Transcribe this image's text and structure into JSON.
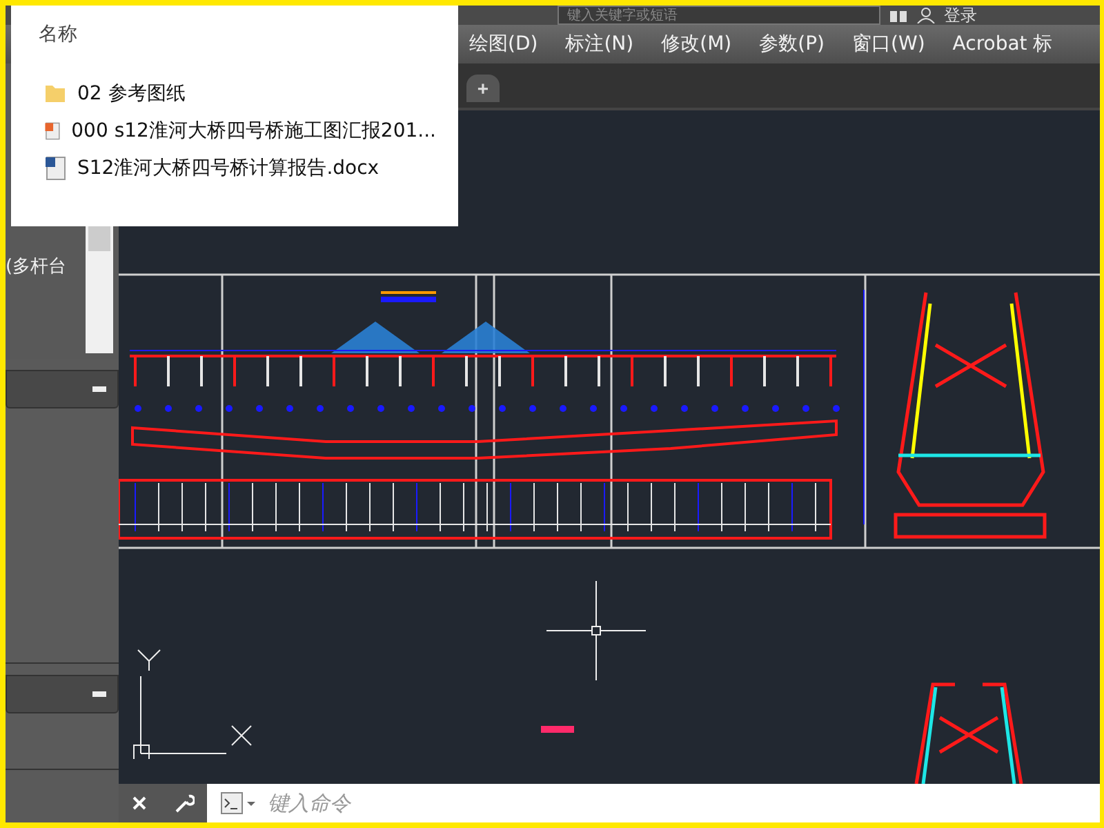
{
  "file_popup": {
    "header": "名称",
    "items": [
      {
        "kind": "folder",
        "name": "02 参考图纸"
      },
      {
        "kind": "pdf",
        "name": "000 s12淮河大桥四号桥施工图汇报201..."
      },
      {
        "kind": "word",
        "name": "S12淮河大桥四号桥计算报告.docx"
      }
    ]
  },
  "title_bar": {
    "search": {
      "placeholder": "键入关键字或短语"
    },
    "sign_in": "登录"
  },
  "menu_bar": [
    "绘图(D)",
    "标注(N)",
    "修改(M)",
    "参数(P)",
    "窗口(W)",
    "Acrobat 标"
  ],
  "doc_tabs": {
    "new_tab": "+"
  },
  "side_panel": {
    "text": "(多杆台"
  },
  "command_line": {
    "placeholder": "键入命令"
  }
}
